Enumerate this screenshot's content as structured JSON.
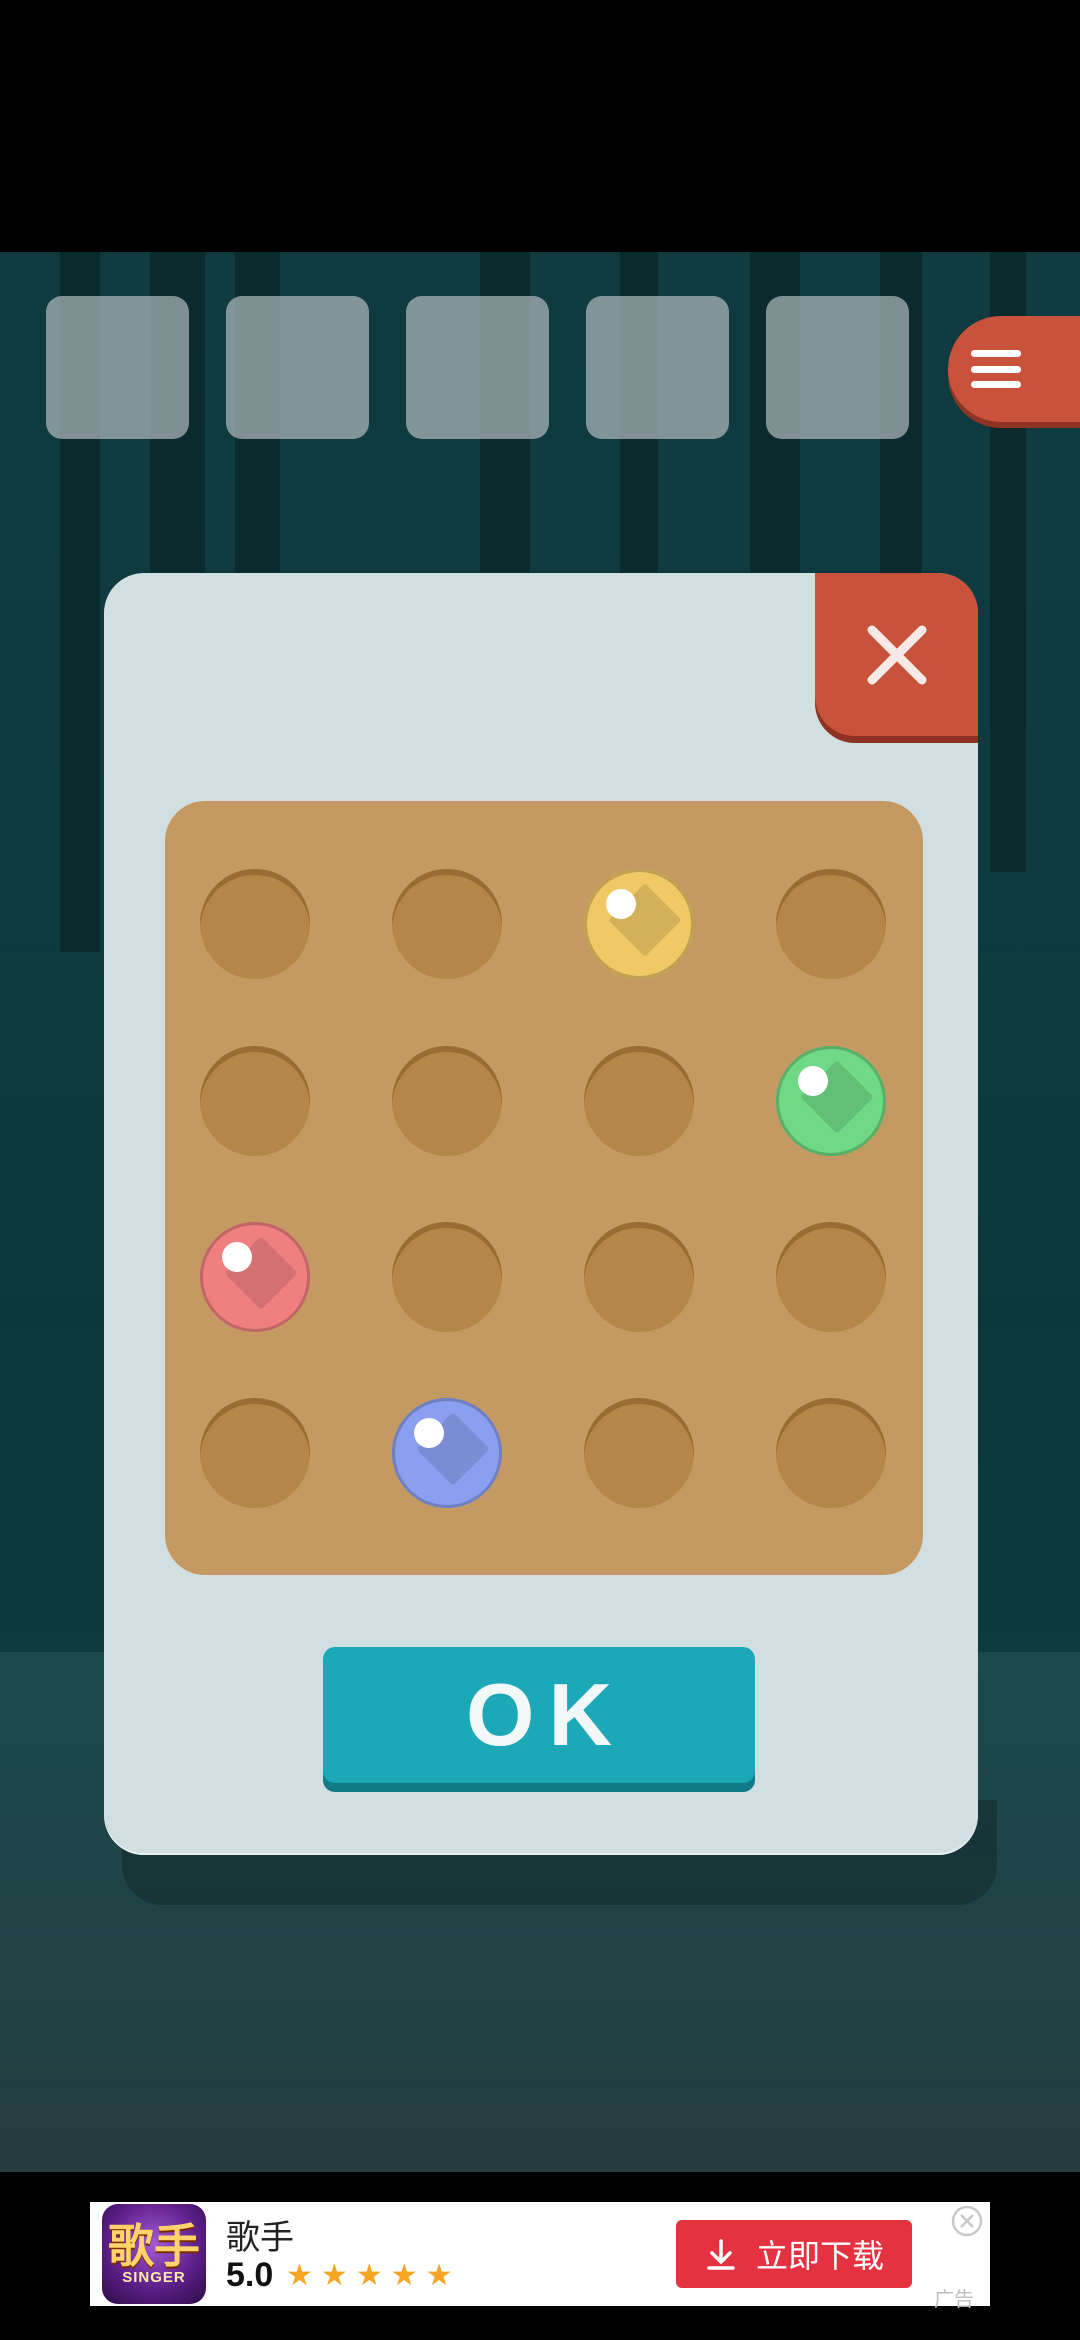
{
  "menu": {
    "icon": "hamburger-menu-icon"
  },
  "slots": [
    {
      "state": "empty"
    },
    {
      "state": "empty"
    },
    {
      "state": "empty"
    },
    {
      "state": "empty"
    },
    {
      "state": "empty"
    }
  ],
  "dialog": {
    "close_icon": "close-x-icon",
    "ok_label": "OK",
    "board": {
      "rows": 4,
      "cols": 4,
      "cells": [
        [
          "empty",
          "empty",
          "yellow",
          "empty"
        ],
        [
          "empty",
          "empty",
          "empty",
          "green"
        ],
        [
          "red",
          "empty",
          "empty",
          "empty"
        ],
        [
          "empty",
          "blue",
          "empty",
          "empty"
        ]
      ]
    }
  },
  "colors": {
    "yellow": "#f0c865",
    "green": "#6fd985",
    "red": "#f07f80",
    "blue": "#8b9ff0",
    "accent_red": "#c8523a",
    "ok_teal": "#1da8b8"
  },
  "ad": {
    "app_name": "歌手",
    "logo_text": "歌手",
    "logo_subtext": "SINGER",
    "rating": "5.0",
    "stars": 5,
    "button_label": "立即下载",
    "tag": "广告"
  }
}
